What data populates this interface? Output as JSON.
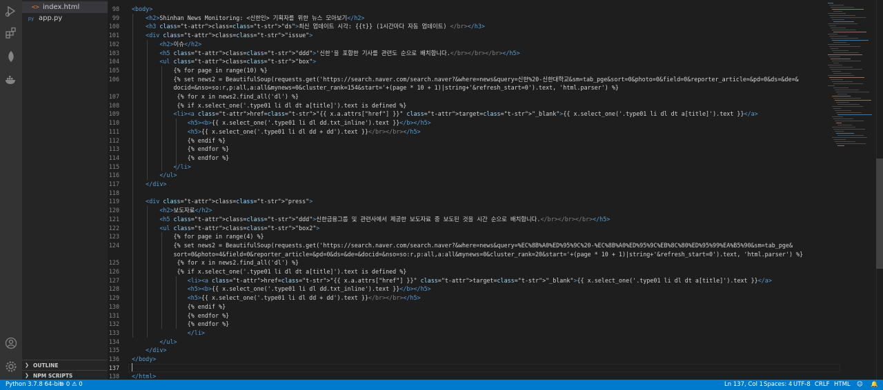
{
  "explorer": {
    "files": [
      {
        "name": "index.html",
        "icon": "<>",
        "active": true
      },
      {
        "name": "app.py",
        "icon": "py",
        "active": false
      }
    ],
    "sections": [
      "OUTLINE",
      "NPM SCRIPTS"
    ]
  },
  "editor": {
    "lines": [
      {
        "n": "98",
        "code": "<body>"
      },
      {
        "n": "99",
        "code": "    <h2>Shinhan News Monitoring: <신한인> 기획자를 위한 뉴스 모아보기</h2>"
      },
      {
        "n": "100",
        "code": "    <h3 class=\"ds\">최신 업데이트 시각: {{t}} (1시간마다 자동 업데이트) </br></h3>"
      },
      {
        "n": "101",
        "code": "    <div class=\"issue\">"
      },
      {
        "n": "102",
        "code": "        <h2>이슈</h2>"
      },
      {
        "n": "103",
        "code": "        <h5 class=\"ddd\">'신한'을 포함한 기사를 관련도 순으로 배치합니다.</br></br></br></h5>"
      },
      {
        "n": "104",
        "code": "        <ul class=\"box\">"
      },
      {
        "n": "105",
        "code": "            {% for page in range(10) %}"
      },
      {
        "n": "106",
        "code": "            {% set news2 = BeautifulSoup(requests.get('https://search.naver.com/search.naver?&where=news&query=신한%20-신한대학교&sm=tab_pge&sort=0&photo=0&field=0&reporter_article=&pd=0&ds=&de=&"
      },
      {
        "n": "",
        "code": "            docid=&nso=so:r,p:all,a:all&mynews=0&cluster_rank=154&start='+(page * 10 + 1)|string+'&refresh_start=0').text, 'html.parser') %}"
      },
      {
        "n": "107",
        "code": "             {% for x in news2.find_all('dl') %}"
      },
      {
        "n": "108",
        "code": "             {% if x.select_one('.type01 li dl dt a[title]').text is defined %}"
      },
      {
        "n": "109",
        "code": "            <li><a href=\"{{ x.a.attrs[\"href\"] }}\" target=\"_blank\">{{ x.select_one('.type01 li dl dt a[title]').text }}</a>"
      },
      {
        "n": "110",
        "code": "                <h5><b>{{ x.select_one('.type01 li dl dd.txt_inline').text }}</b></h5>"
      },
      {
        "n": "111",
        "code": "                <h5>{{ x.select_one('.type01 li dl dd + dd').text }}</br></br></h5>"
      },
      {
        "n": "112",
        "code": "                {% endif %}"
      },
      {
        "n": "113",
        "code": "                {% endfor %}"
      },
      {
        "n": "114",
        "code": "                {% endfor %}"
      },
      {
        "n": "115",
        "code": "            </li>"
      },
      {
        "n": "116",
        "code": "        </ul>"
      },
      {
        "n": "117",
        "code": "    </div>"
      },
      {
        "n": "118",
        "code": ""
      },
      {
        "n": "119",
        "code": "    <div class=\"press\">"
      },
      {
        "n": "120",
        "code": "        <h2>보도자료</h2>"
      },
      {
        "n": "121",
        "code": "        <h5 class=\"ddd\">신한금융그룹 및 관련사에서 제공한 보도자료 중 보도된 것을 시간 순으로 배치합니다.</br></br></br></h5>"
      },
      {
        "n": "122",
        "code": "        <ul class=\"box2\">"
      },
      {
        "n": "123",
        "code": "            {% for page in range(4) %}"
      },
      {
        "n": "124",
        "code": "            {% set news2 = BeautifulSoup(requests.get('https://search.naver.com/search.naver?&where=news&query=%EC%8B%A0%ED%95%9C%20-%EC%8B%A0%ED%95%9C%EB%8C%80%ED%95%99%EA%B5%90&sm=tab_pge&"
      },
      {
        "n": "",
        "code": "            sort=0&photo=4&field=0&reporter_article=&pd=0&ds=&de=&docid=&nso=so:r,p:all,a:all&mynews=0&cluster_rank=20&start='+(page * 10 + 1)|string+'&refresh_start=0').text, 'html.parser') %}"
      },
      {
        "n": "125",
        "code": "             {% for x in news2.find_all('dl') %}"
      },
      {
        "n": "126",
        "code": "             {% if x.select_one('.type01 li dl dt a[title]').text is defined %}"
      },
      {
        "n": "127",
        "code": "                <li><a href=\"{{ x.a.attrs[\"href\"] }}\" target=\"_blank\">{{ x.select_one('.type01 li dl dt a[title]').text }}</a>"
      },
      {
        "n": "128",
        "code": "                <h5><b>{{ x.select_one('.type01 li dl dd.txt_inline').text }}</b></h5>"
      },
      {
        "n": "129",
        "code": "                <h5>{{ x.select_one('.type01 li dl dd + dd').text }}</br></br></h5>"
      },
      {
        "n": "130",
        "code": "                {% endif %}"
      },
      {
        "n": "131",
        "code": "                {% endfor %}"
      },
      {
        "n": "132",
        "code": "                {% endfor %}"
      },
      {
        "n": "133",
        "code": "                </li>"
      },
      {
        "n": "134",
        "code": "        </ul>"
      },
      {
        "n": "135",
        "code": "    </div>"
      },
      {
        "n": "136",
        "code": "</body>"
      },
      {
        "n": "137",
        "code": ""
      },
      {
        "n": "138",
        "code": "</html>"
      }
    ],
    "current_line": "137"
  },
  "status": {
    "python": "Python 3.7.8 64-bit",
    "problems": "0",
    "warnings": "0",
    "position": "Ln 137, Col 1",
    "spaces": "Spaces: 4",
    "encoding": "UTF-8",
    "eol": "CRLF",
    "language": "HTML"
  },
  "colors": {
    "status_bar": "#007acc",
    "activity_bar": "#333333",
    "sidebar": "#252526",
    "editor_bg": "#1e1e1e",
    "tag": "#569cd6",
    "attr": "#9cdcfe",
    "string": "#ce9178"
  }
}
